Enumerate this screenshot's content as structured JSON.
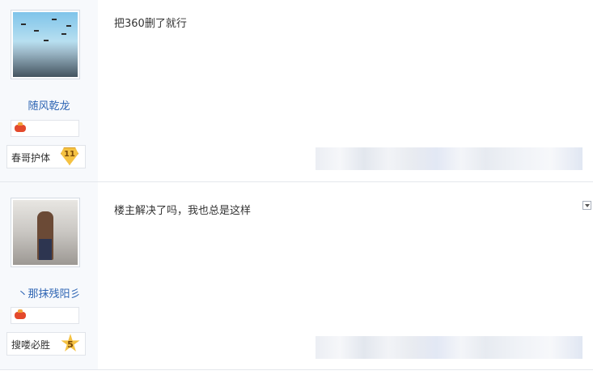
{
  "posts": [
    {
      "author": {
        "name": "随风乾龙",
        "level_name": "春哥护体",
        "level": "11"
      },
      "content": "把360删了就行"
    },
    {
      "author": {
        "name": "丶那抹残阳彡",
        "level_name": "搜喽必胜",
        "level": "5"
      },
      "content": "楼主解决了吗，我也总是这样"
    }
  ],
  "icons": {
    "badge": "gamepad-icon",
    "post_menu": "chevron-down-icon"
  },
  "colors": {
    "username": "#2d64b3",
    "sidebar_bg": "#f7f9fc",
    "level_badge": "#f5c242"
  }
}
